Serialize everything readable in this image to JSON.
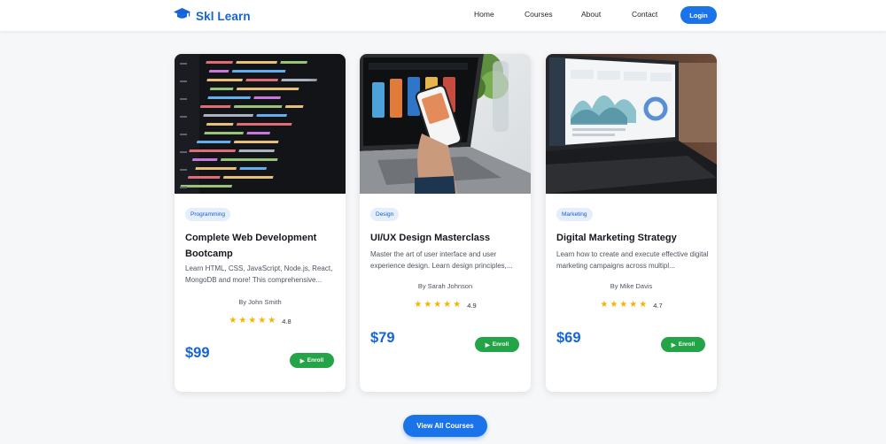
{
  "brand": {
    "name": "Skl Learn",
    "icon": "graduation-cap-icon",
    "color": "#1565d8"
  },
  "nav": {
    "links": [
      "Home",
      "Courses",
      "About",
      "Contact"
    ],
    "login_label": "Login"
  },
  "courses": [
    {
      "tag": "Programming",
      "title": "Complete Web Development Bootcamp",
      "description": "Learn HTML, CSS, JavaScript, Node.js, React, MongoDB and more! This comprehensive...",
      "author": "By John Smith",
      "rating": "4.8",
      "price": "$99",
      "enroll_label": "Enroll",
      "image": "code-editor-image"
    },
    {
      "tag": "Design",
      "title": "UI/UX Design Masterclass",
      "description": "Master the art of user interface and user experience design. Learn design principles,...",
      "author": "By Sarah Johnson",
      "rating": "4.9",
      "price": "$79",
      "enroll_label": "Enroll",
      "image": "laptop-phone-design-image"
    },
    {
      "tag": "Marketing",
      "title": "Digital Marketing Strategy",
      "description": "Learn how to create and execute effective digital marketing campaigns across multipl...",
      "author": "By Mike Davis",
      "rating": "4.7",
      "price": "$69",
      "enroll_label": "Enroll",
      "image": "analytics-dashboard-image"
    }
  ],
  "view_all_label": "View All Courses",
  "colors": {
    "primary": "#1a73e8",
    "enroll": "#22a447",
    "star": "#f4b400",
    "tag_bg": "#e4eefc"
  }
}
